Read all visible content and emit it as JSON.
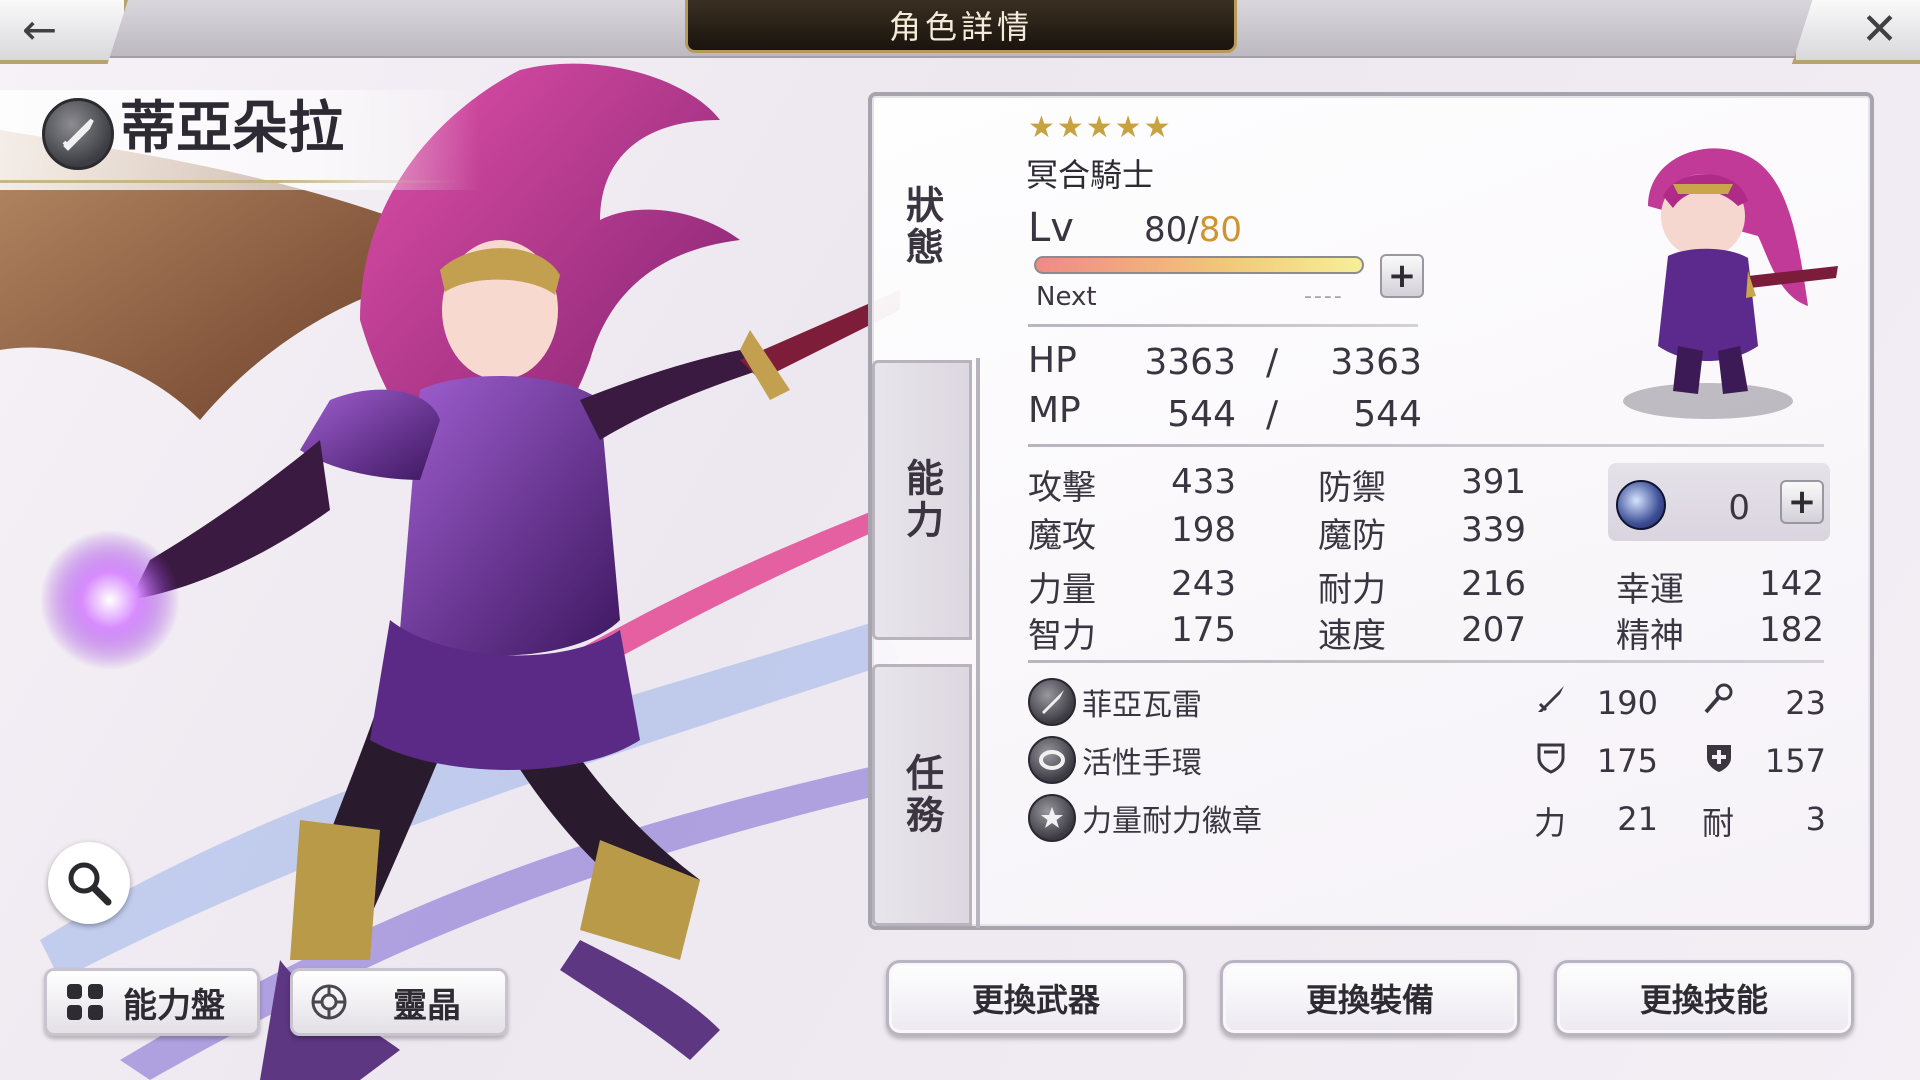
{
  "header": {
    "title": "角色詳情",
    "back_icon": "arrow-left-icon",
    "close_icon": "close-icon"
  },
  "character": {
    "name": "蒂亞朵拉",
    "job": "冥合騎士",
    "stars": "★★★★★",
    "level": "80/",
    "level_max": "80",
    "exp_progress": 1.0,
    "next_label": "Next",
    "next_value": "----",
    "lv_label": "Lv"
  },
  "tabs": [
    "狀態",
    "能力",
    "任務"
  ],
  "vitals": {
    "hp": {
      "label": "HP",
      "current": "3363",
      "sep": "/",
      "max": "3363"
    },
    "mp": {
      "label": "MP",
      "current": "544",
      "sep": "/",
      "max": "544"
    }
  },
  "stats": [
    {
      "label": "攻擊",
      "value": "433"
    },
    {
      "label": "防禦",
      "value": "391"
    },
    {
      "label": "魔攻",
      "value": "198"
    },
    {
      "label": "魔防",
      "value": "339"
    },
    {
      "label": "力量",
      "value": "243"
    },
    {
      "label": "耐力",
      "value": "216"
    },
    {
      "label": "幸運",
      "value": "142"
    },
    {
      "label": "智力",
      "value": "175"
    },
    {
      "label": "速度",
      "value": "207"
    },
    {
      "label": "精神",
      "value": "182"
    }
  ],
  "orb": {
    "count": "0"
  },
  "equipment": [
    {
      "name": "菲亞瓦雷",
      "icon": "sword-icon",
      "stat1_icon": "sword-icon",
      "stat1": "190",
      "stat2_icon": "staff-icon",
      "stat2": "23"
    },
    {
      "name": "活性手環",
      "icon": "bracelet-icon",
      "stat1_icon": "shield-icon",
      "stat1": "175",
      "stat2_icon": "magic-shield-icon",
      "stat2": "157"
    },
    {
      "name": "力量耐力徽章",
      "icon": "star-badge-icon",
      "stat1_icon": "力",
      "stat1": "21",
      "stat2_icon": "耐",
      "stat2": "3"
    }
  ],
  "left_buttons": [
    {
      "label": "能力盤",
      "icon": "ability-board-icon"
    },
    {
      "label": "靈晶",
      "icon": "spirit-crystal-icon"
    }
  ],
  "bottom_buttons": [
    "更換武器",
    "更換裝備",
    "更換技能"
  ],
  "colors": {
    "level_max": "#cf9330",
    "star": "#c7a23f",
    "frame_gold": "#b8a270"
  }
}
